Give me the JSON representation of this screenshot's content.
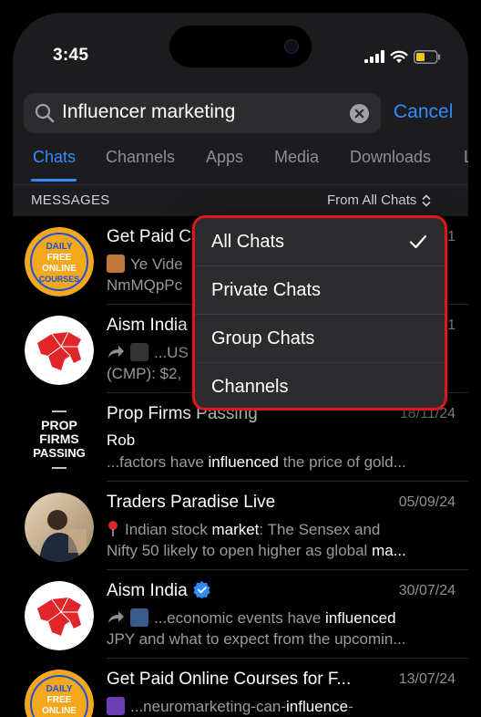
{
  "status_bar": {
    "time": "3:45"
  },
  "search": {
    "query": "Influencer marketing",
    "cancel_label": "Cancel"
  },
  "tabs": [
    {
      "label": "Chats",
      "active": true
    },
    {
      "label": "Channels",
      "active": false
    },
    {
      "label": "Apps",
      "active": false
    },
    {
      "label": "Media",
      "active": false
    },
    {
      "label": "Downloads",
      "active": false
    },
    {
      "label": "L",
      "active": false
    }
  ],
  "section": {
    "label": "MESSAGES",
    "filter_label": "From All Chats"
  },
  "rows": [
    {
      "title": "Get Paid C",
      "date": "1",
      "line1": "Ye Vide",
      "line2": "NmMQpPc",
      "avatar": "DAILY FREE ONLINE COURSES"
    },
    {
      "title": "Aism India",
      "date": "1",
      "line1": "...US",
      "line2": "(CMP): $2,",
      "avatar": "aism-logo"
    },
    {
      "title": "Prop Firms Passing",
      "date": "18/11/24",
      "line1": "Rob",
      "line2_pre": "...factors have ",
      "line2_hl": "influenced",
      "line2_post": " the price of gold...",
      "avatar": "PROP FIRMS PASSING"
    },
    {
      "title": "Traders Paradise Live",
      "date": "05/09/24",
      "line1_pre": "Indian stock ",
      "line1_hl": "market",
      "line1_post": ": The Sensex and",
      "line2_pre": "Nifty 50 likely to open higher as global ",
      "line2_hl": "ma...",
      "avatar": "person-photo"
    },
    {
      "title": "Aism India",
      "date": "30/07/24",
      "line1_pre": "...economic events have ",
      "line1_hl": "influenced",
      "line2": "JPY and what to expect from the upcomin...",
      "avatar": "aism-logo"
    },
    {
      "title": "Get Paid Online Courses for F...",
      "date": "13/07/24",
      "line1_pre": "...neuromarketing-can-",
      "line1_hl": "influence",
      "line1_post": "-",
      "avatar": "DAILY FREE ONLINE COURSES"
    }
  ],
  "menu": {
    "items": [
      {
        "label": "All Chats",
        "checked": true
      },
      {
        "label": "Private Chats",
        "checked": false
      },
      {
        "label": "Group Chats",
        "checked": false
      },
      {
        "label": "Channels",
        "checked": false
      }
    ]
  },
  "colors": {
    "accent": "#2f8bff",
    "highlight_border": "#e0161b",
    "course_badge": "#f6a81d",
    "aism_red": "#e0252b",
    "verified": "#2f8bff"
  }
}
